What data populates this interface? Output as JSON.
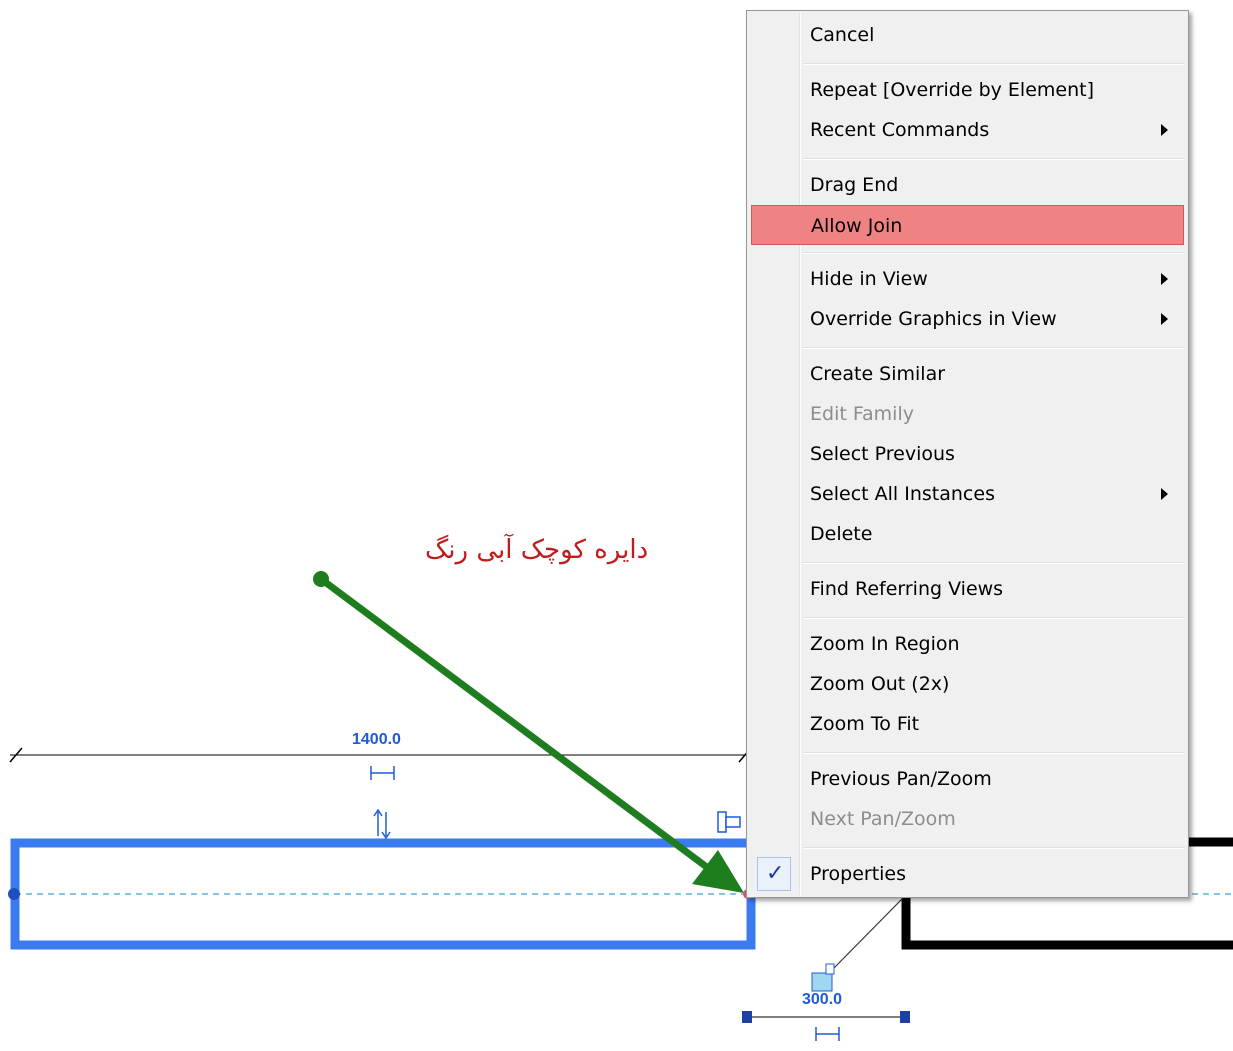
{
  "annotation": {
    "text": "دایره کوچک آبی رنگ",
    "color": "#c21b1b",
    "arrow_color": "#1e7d1e"
  },
  "drawing": {
    "dimension_top": "1400.0",
    "dimension_bottom": "300.0",
    "wall_color": "#3b7bf0",
    "centerline_color": "#3aa0d4"
  },
  "menu": {
    "items": [
      {
        "label": "Cancel",
        "submenu": false,
        "disabled": false
      },
      {
        "label": "Repeat [Override by Element]",
        "submenu": false,
        "disabled": false
      },
      {
        "label": "Recent Commands",
        "submenu": true,
        "disabled": false
      },
      {
        "label": "Drag End",
        "submenu": false,
        "disabled": false
      },
      {
        "label": "Allow Join",
        "submenu": false,
        "disabled": false,
        "highlighted": true
      },
      {
        "label": "Hide in View",
        "submenu": true,
        "disabled": false
      },
      {
        "label": "Override Graphics in View",
        "submenu": true,
        "disabled": false
      },
      {
        "label": "Create Similar",
        "submenu": false,
        "disabled": false
      },
      {
        "label": "Edit Family",
        "submenu": false,
        "disabled": true
      },
      {
        "label": "Select Previous",
        "submenu": false,
        "disabled": false
      },
      {
        "label": "Select All Instances",
        "submenu": true,
        "disabled": false
      },
      {
        "label": "Delete",
        "submenu": false,
        "disabled": false
      },
      {
        "label": "Find Referring Views",
        "submenu": false,
        "disabled": false
      },
      {
        "label": "Zoom In Region",
        "submenu": false,
        "disabled": false
      },
      {
        "label": "Zoom Out (2x)",
        "submenu": false,
        "disabled": false
      },
      {
        "label": "Zoom To Fit",
        "submenu": false,
        "disabled": false
      },
      {
        "label": "Previous Pan/Zoom",
        "submenu": false,
        "disabled": false
      },
      {
        "label": "Next Pan/Zoom",
        "submenu": false,
        "disabled": true
      },
      {
        "label": "Properties",
        "submenu": false,
        "disabled": false,
        "checked": true
      }
    ],
    "highlight_color": "#ef8383"
  }
}
